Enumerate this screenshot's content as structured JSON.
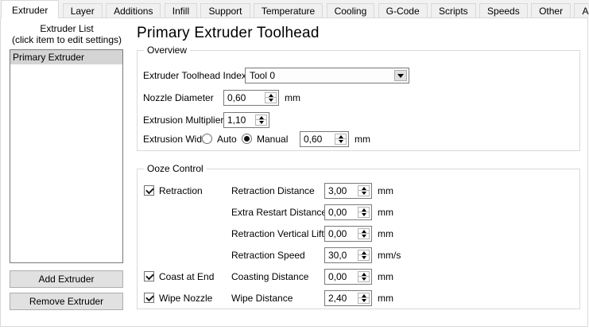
{
  "tabs": {
    "items": [
      {
        "label": "Extruder",
        "active": true
      },
      {
        "label": "Layer",
        "active": false
      },
      {
        "label": "Additions",
        "active": false
      },
      {
        "label": "Infill",
        "active": false
      },
      {
        "label": "Support",
        "active": false
      },
      {
        "label": "Temperature",
        "active": false
      },
      {
        "label": "Cooling",
        "active": false
      },
      {
        "label": "G-Code",
        "active": false
      },
      {
        "label": "Scripts",
        "active": false
      },
      {
        "label": "Speeds",
        "active": false
      },
      {
        "label": "Other",
        "active": false
      },
      {
        "label": "Advanced",
        "active": false
      }
    ]
  },
  "sidebar": {
    "title_line1": "Extruder List",
    "title_line2": "(click item to edit settings)",
    "list_items": [
      {
        "label": "Primary Extruder",
        "selected": true
      }
    ],
    "add_button": "Add Extruder",
    "remove_button": "Remove Extruder"
  },
  "main": {
    "title": "Primary Extruder Toolhead",
    "overview": {
      "legend": "Overview",
      "toolhead_index": {
        "label": "Extruder Toolhead Index",
        "value": "Tool 0"
      },
      "nozzle_diameter": {
        "label": "Nozzle Diameter",
        "value": "0,60",
        "unit": "mm"
      },
      "extrusion_multiplier": {
        "label": "Extrusion Multiplier",
        "value": "1,10"
      },
      "extrusion_width": {
        "label": "Extrusion Width",
        "auto_label": "Auto",
        "manual_label": "Manual",
        "selected": "Manual",
        "value": "0,60",
        "unit": "mm"
      }
    },
    "ooze_control": {
      "legend": "Ooze Control",
      "checkboxes": [
        {
          "label": "Retraction",
          "checked": true
        },
        {
          "label": "Coast at End",
          "checked": true
        },
        {
          "label": "Wipe Nozzle",
          "checked": true
        }
      ],
      "fields": [
        {
          "label": "Retraction Distance",
          "value": "3,00",
          "unit": "mm"
        },
        {
          "label": "Extra Restart Distance",
          "value": "0,00",
          "unit": "mm"
        },
        {
          "label": "Retraction Vertical Lift",
          "value": "0,00",
          "unit": "mm"
        },
        {
          "label": "Retraction Speed",
          "value": "30,0",
          "unit": "mm/s"
        },
        {
          "label": "Coasting Distance",
          "value": "0,00",
          "unit": "mm"
        },
        {
          "label": "Wipe Distance",
          "value": "2,40",
          "unit": "mm"
        }
      ]
    }
  },
  "colors": {
    "selection_bg": "#d4d4d4",
    "button_bg": "#e1e1e1",
    "pane_border": "#d9d9d9",
    "input_border": "#7a7a7a"
  }
}
